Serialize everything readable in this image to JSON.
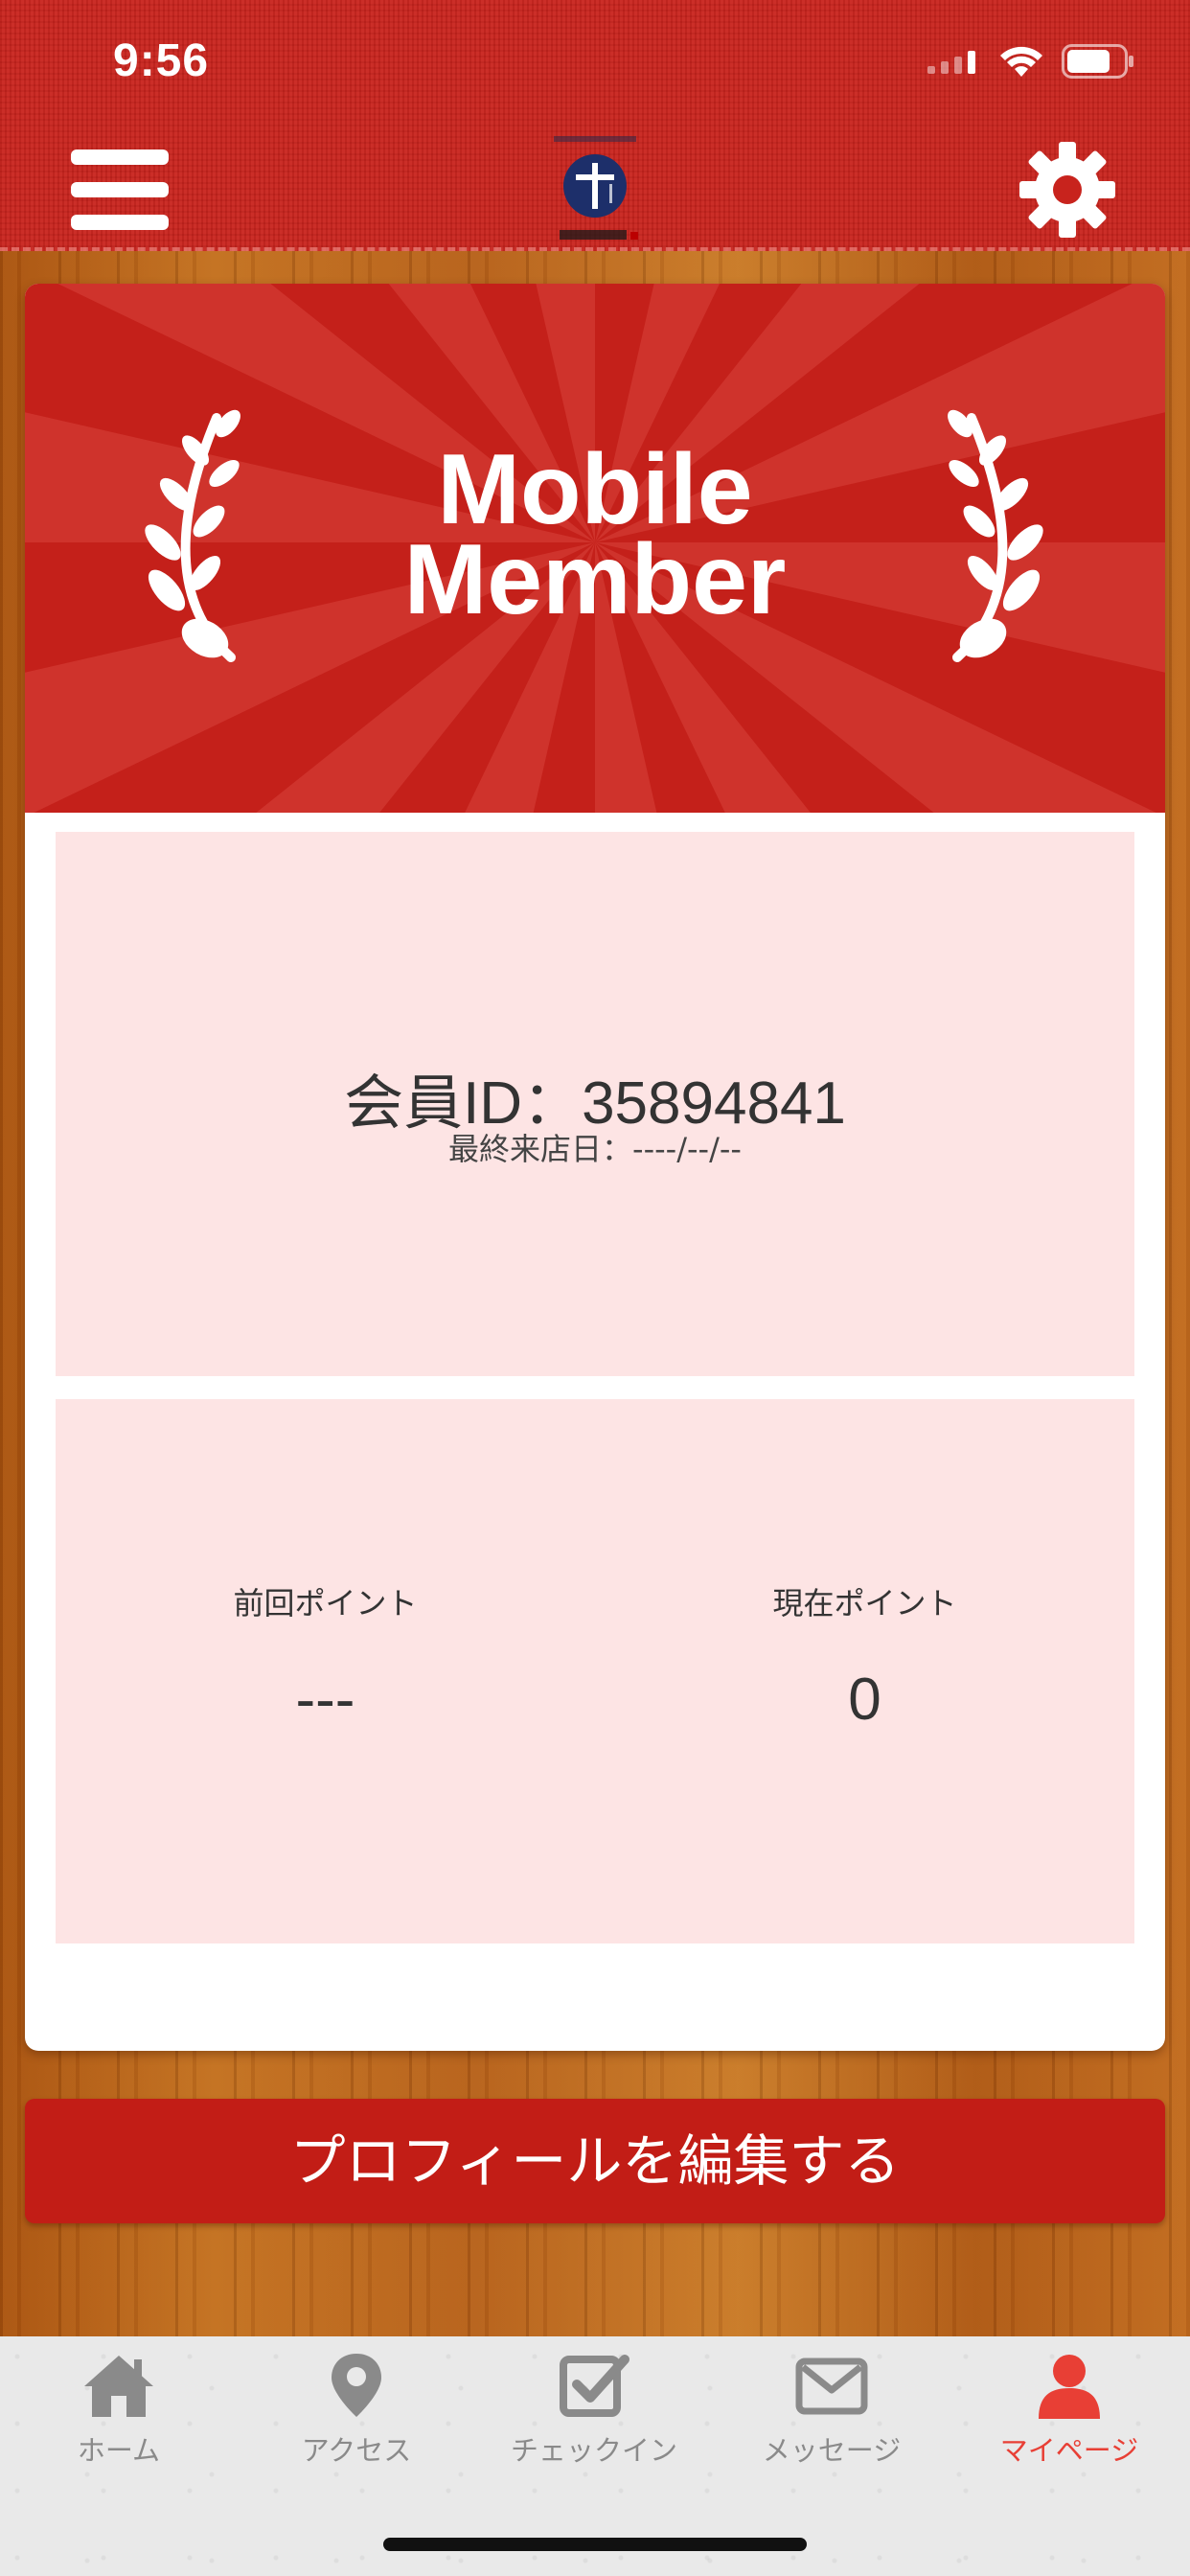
{
  "status_bar": {
    "time": "9:56"
  },
  "colors": {
    "brand_red": "#c4201a",
    "panel_pink": "#fde4e4",
    "tab_active": "#e83f35",
    "tab_inactive": "#8a8a8a"
  },
  "header": {
    "menu_icon": "hamburger-menu-icon",
    "logo": "restaurant-logo",
    "settings_icon": "gear-icon"
  },
  "banner": {
    "line1": "Mobile",
    "line2": "Member"
  },
  "member": {
    "id_text": "会員ID：35894841",
    "last_visit_text": "最終来店日：----/--/--"
  },
  "points": {
    "previous_label": "前回ポイント",
    "previous_value": "---",
    "current_label": "現在ポイント",
    "current_value": "0"
  },
  "edit_profile_label": "プロフィールを編集する",
  "tabs": [
    {
      "label": "ホーム",
      "icon": "home-icon",
      "active": false
    },
    {
      "label": "アクセス",
      "icon": "map-pin-icon",
      "active": false
    },
    {
      "label": "チェックイン",
      "icon": "checkbox-icon",
      "active": false
    },
    {
      "label": "メッセージ",
      "icon": "envelope-icon",
      "active": false
    },
    {
      "label": "マイページ",
      "icon": "person-icon",
      "active": true
    }
  ]
}
